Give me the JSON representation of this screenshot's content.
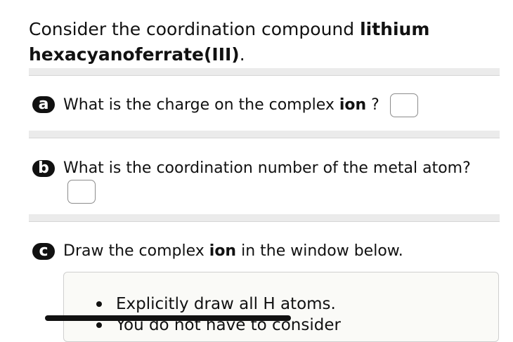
{
  "intro": {
    "prefix": "Consider the coordination compound ",
    "compound_bold": "lithium hexacyanoferrate(III)",
    "suffix": "."
  },
  "questions": [
    {
      "badge": "a",
      "text_before": "What is the charge on the complex ",
      "text_bold": "ion",
      "text_after": " ?"
    },
    {
      "badge": "b",
      "text": "What is the coordination number of the metal atom?"
    },
    {
      "badge": "c",
      "text_before": "Draw the complex ",
      "text_bold": "ion",
      "text_after": " in the window below."
    }
  ],
  "instructions": [
    "Explicitly draw all H atoms.",
    "You do not have to consider"
  ],
  "colors": {
    "badge_bg": "#111111",
    "divider": "#ebebeb",
    "answer_box_border": "#8c8c8c"
  }
}
